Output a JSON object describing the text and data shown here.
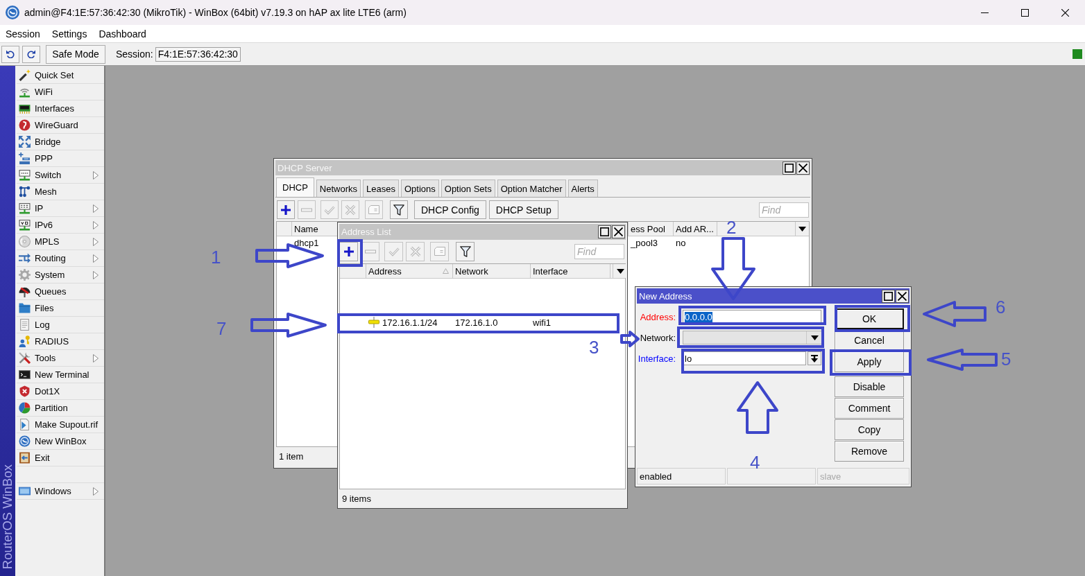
{
  "window": {
    "title": "admin@F4:1E:57:36:42:30 (MikroTik) - WinBox (64bit) v7.19.3 on hAP ax lite LTE6 (arm)"
  },
  "menu": [
    "Session",
    "Settings",
    "Dashboard"
  ],
  "toolbar": {
    "safe_mode": "Safe Mode",
    "session_label": "Session:",
    "session_value": "F4:1E:57:36:42:30"
  },
  "sidebar": {
    "brand": "RouterOS WinBox",
    "items": [
      {
        "label": "Quick Set",
        "submenu": false
      },
      {
        "label": "WiFi",
        "submenu": false
      },
      {
        "label": "Interfaces",
        "submenu": false
      },
      {
        "label": "WireGuard",
        "submenu": false
      },
      {
        "label": "Bridge",
        "submenu": false
      },
      {
        "label": "PPP",
        "submenu": false
      },
      {
        "label": "Switch",
        "submenu": true
      },
      {
        "label": "Mesh",
        "submenu": false
      },
      {
        "label": "IP",
        "submenu": true
      },
      {
        "label": "IPv6",
        "submenu": true
      },
      {
        "label": "MPLS",
        "submenu": true
      },
      {
        "label": "Routing",
        "submenu": true
      },
      {
        "label": "System",
        "submenu": true
      },
      {
        "label": "Queues",
        "submenu": false
      },
      {
        "label": "Files",
        "submenu": false
      },
      {
        "label": "Log",
        "submenu": false
      },
      {
        "label": "RADIUS",
        "submenu": false
      },
      {
        "label": "Tools",
        "submenu": true
      },
      {
        "label": "New Terminal",
        "submenu": false
      },
      {
        "label": "Dot1X",
        "submenu": false
      },
      {
        "label": "Partition",
        "submenu": false
      },
      {
        "label": "Make Supout.rif",
        "submenu": false
      },
      {
        "label": "New WinBox",
        "submenu": false
      },
      {
        "label": "Exit",
        "submenu": false
      }
    ],
    "bottom_items": [
      {
        "label": "Windows",
        "submenu": true
      }
    ]
  },
  "dhcp_window": {
    "title": "DHCP Server",
    "active": false,
    "tabs": [
      {
        "label": "DHCP",
        "selected": true
      },
      {
        "label": "Networks",
        "selected": false
      },
      {
        "label": "Leases",
        "selected": false
      },
      {
        "label": "Options",
        "selected": false
      },
      {
        "label": "Option Sets",
        "selected": false
      },
      {
        "label": "Option Matcher",
        "selected": false
      },
      {
        "label": "Alerts",
        "selected": false
      }
    ],
    "toolbar": {
      "icon_buttons": [
        {
          "kind": "add",
          "disabled": false
        },
        {
          "kind": "remove",
          "disabled": true
        },
        {
          "kind": "enable",
          "disabled": true
        },
        {
          "kind": "disable",
          "disabled": true
        },
        {
          "kind": "comment",
          "disabled": true
        },
        {
          "kind": "filter",
          "disabled": false
        }
      ],
      "buttons": [
        "DHCP Config",
        "DHCP Setup"
      ],
      "find_placeholder": "Find"
    },
    "table": {
      "columns": [
        {
          "label": "Name"
        },
        {
          "label": "ess Pool"
        },
        {
          "label": "Add AR..."
        }
      ],
      "rows": [
        {
          "cells": [
            "dhcp1",
            "_pool3",
            "no"
          ]
        }
      ]
    },
    "status": "1 item"
  },
  "address_list_window": {
    "title": "Address List",
    "active": false,
    "toolbar": {
      "icon_buttons": [
        {
          "kind": "add",
          "disabled": false
        },
        {
          "kind": "remove",
          "disabled": true
        },
        {
          "kind": "enable",
          "disabled": true
        },
        {
          "kind": "disable",
          "disabled": true
        },
        {
          "kind": "comment",
          "disabled": true
        },
        {
          "kind": "filter",
          "disabled": false
        }
      ],
      "find_placeholder": "Find"
    },
    "table": {
      "columns": [
        {
          "label": "Address",
          "sorted": true
        },
        {
          "label": "Network",
          "sorted": false
        },
        {
          "label": "Interface",
          "sorted": false
        }
      ],
      "rows": [
        {
          "cells": [
            "172.16.1.1/24",
            "172.16.1.0",
            "wifi1"
          ]
        }
      ]
    },
    "status": "9 items"
  },
  "new_address_window": {
    "title": "New Address",
    "active": true,
    "fields": [
      {
        "kind": "text",
        "label": "Address:",
        "color": "#ff0000",
        "value": "0.0.0.0",
        "value_selected": true,
        "disabled": false
      },
      {
        "kind": "select",
        "label": "Network:",
        "color": "#000000",
        "disabled": true
      },
      {
        "kind": "combo",
        "label": "Interface:",
        "color": "#0000ff",
        "value": "lo",
        "disabled": false
      }
    ],
    "buttons": [
      {
        "label": "OK",
        "default": true
      },
      {
        "label": "Cancel",
        "default": false
      },
      {
        "label": "Apply",
        "default": false
      }
    ],
    "action_buttons": [
      "Disable",
      "Comment",
      "Copy",
      "Remove"
    ],
    "status_bar": [
      {
        "kind": "text",
        "text": "enabled",
        "greyed": false
      },
      {
        "kind": "empty"
      },
      {
        "kind": "text",
        "text": "slave",
        "greyed": true
      }
    ]
  },
  "annotations": {
    "step_numbers": [
      "1",
      "2",
      "3",
      "4",
      "5",
      "6",
      "7"
    ]
  }
}
